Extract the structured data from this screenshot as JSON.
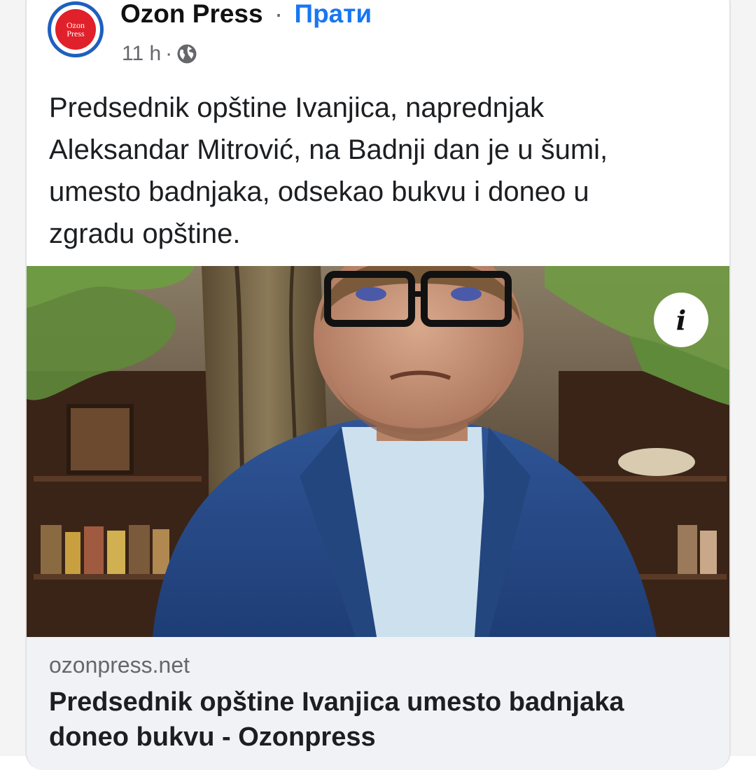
{
  "post": {
    "page_name": "Ozon Press",
    "separator": "·",
    "follow_label": "Прати",
    "timestamp": "11 h",
    "meta_separator": "·",
    "privacy_icon": "globe-icon",
    "avatar": {
      "logo_text_line1": "Ozon",
      "logo_text_line2": "Press",
      "ring_color": "#1f5fbf",
      "fill_color": "#e0202a"
    },
    "text": "Predsednik opštine Ivanjica, naprednjak\nAleksandar Mitrović, na Badnji dan je u šumi,\numesto badnjaka, odsekao bukvu i doneo u\nzgradu opštine.",
    "image_info_icon": "info-icon",
    "image_info_glyph": "i"
  },
  "link_preview": {
    "domain": "ozonpress.net",
    "title": "Predsednik opštine Ivanjica umesto badnjaka\ndoneo bukvu - Ozonpress"
  },
  "colors": {
    "link_blue": "#1877f2",
    "meta_gray": "#65676b",
    "preview_bg": "#f0f2f5"
  }
}
